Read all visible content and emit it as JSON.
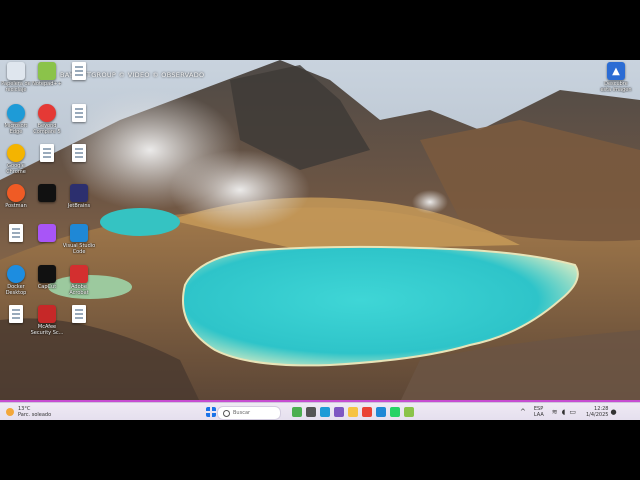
{
  "overlay_title": "BAYSOFTGROUP © VIDEO © OBSERVADO",
  "desktop": {
    "icons": [
      {
        "label": "Papelera de reciclaje",
        "glyph": "recycle-bin-icon",
        "color": "#dfe6ee"
      },
      {
        "label": "Notepad++",
        "glyph": "notepad-plus-plus-icon",
        "color": "#8bc34a"
      },
      {
        "label": "",
        "glyph": "document-icon",
        "color": "#ffffff"
      },
      {
        "label": "Microsoft Edge",
        "glyph": "edge-icon",
        "color": "#1e9bd7"
      },
      {
        "label": "Beyond Compare 5",
        "glyph": "beyond-compare-icon",
        "color": "#e53935"
      },
      {
        "label": "",
        "glyph": "document-icon",
        "color": "#ffffff"
      },
      {
        "label": "Google Chrome",
        "glyph": "chrome-icon",
        "color": "#f4b400"
      },
      {
        "label": "",
        "glyph": "document-icon",
        "color": "#ffffff"
      },
      {
        "label": "",
        "glyph": "document-icon",
        "color": "#ffffff"
      },
      {
        "label": "Postman",
        "glyph": "postman-icon",
        "color": "#ef5b25"
      },
      {
        "label": "",
        "glyph": "dark-app-icon",
        "color": "#111111"
      },
      {
        "label": "JetBrains",
        "glyph": "jetbrains-icon",
        "color": "#2c2f6e"
      },
      {
        "label": "",
        "glyph": "document-icon",
        "color": "#ffffff"
      },
      {
        "label": "",
        "glyph": "purple-app-icon",
        "color": "#a855f7"
      },
      {
        "label": "Visual Studio Code",
        "glyph": "vscode-icon",
        "color": "#1f88d6"
      },
      {
        "label": "Docker Desktop",
        "glyph": "docker-icon",
        "color": "#1d8de0"
      },
      {
        "label": "CapCut",
        "glyph": "capcut-icon",
        "color": "#111111"
      },
      {
        "label": "Adobe Acrobat",
        "glyph": "acrobat-icon",
        "color": "#d32f2f"
      },
      {
        "label": "",
        "glyph": "document-icon",
        "color": "#ffffff"
      },
      {
        "label": "McAfee Security Sc...",
        "glyph": "mcafee-icon",
        "color": "#c62828"
      },
      {
        "label": "",
        "glyph": "document-icon",
        "color": "#ffffff"
      }
    ],
    "right_icon": {
      "label": "Descubre esta imagen",
      "glyph": "spotlight-image-icon",
      "color": "#2b6cd4"
    }
  },
  "taskbar": {
    "weather": {
      "temp": "13°C",
      "desc": "Parc. soleado"
    },
    "search_placeholder": "Buscar",
    "pinned": [
      {
        "glyph": "start-icon",
        "color": "#1a73e8"
      },
      {
        "glyph": "widgets-icon",
        "color": "#4caf50"
      },
      {
        "glyph": "taskview-icon",
        "color": "#555555"
      },
      {
        "glyph": "edge-taskbar-icon",
        "color": "#1e9bd7"
      },
      {
        "glyph": "store-icon",
        "color": "#7e57c2"
      },
      {
        "glyph": "explorer-icon",
        "color": "#f6c342"
      },
      {
        "glyph": "chrome-taskbar-icon",
        "color": "#ea4335"
      },
      {
        "glyph": "vscode-taskbar-icon",
        "color": "#1f88d6"
      },
      {
        "glyph": "whatsapp-icon",
        "color": "#25d366"
      },
      {
        "glyph": "notepad-taskbar-icon",
        "color": "#8bc34a"
      }
    ],
    "tray": {
      "lang": "ESP",
      "lang_sub": "LAA",
      "time": "12:28",
      "date": "1/4/2025"
    }
  }
}
